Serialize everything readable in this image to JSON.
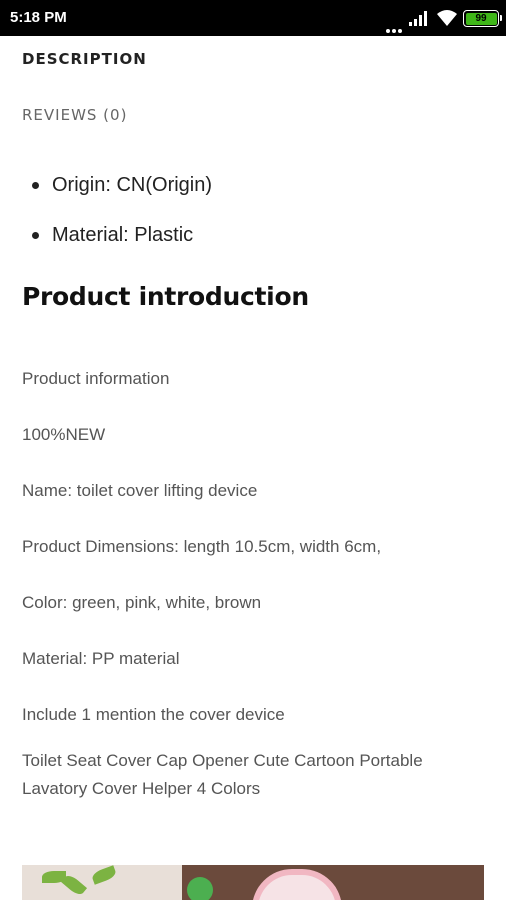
{
  "status_bar": {
    "time": "5:18 PM",
    "battery": "99"
  },
  "tabs": {
    "description": "DESCRIPTION",
    "reviews": "REVIEWS (0)"
  },
  "attributes": [
    "Origin: CN(Origin)",
    "Material: Plastic"
  ],
  "section_title": "Product introduction",
  "info_lines": [
    "Product information",
    "100%NEW",
    "Name: toilet cover lifting device",
    "Product Dimensions: length 10.5cm, width 6cm,",
    "Color: green, pink, white, brown",
    "Material: PP material",
    "Include 1 mention the cover device",
    "Toilet Seat Cover Cap Opener Cute Cartoon Portable Lavatory Cover Helper 4 Colors"
  ],
  "colors": {
    "battery": "#3fb618",
    "status_bar_bg": "#000000"
  }
}
